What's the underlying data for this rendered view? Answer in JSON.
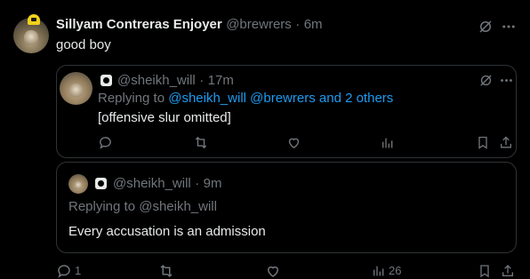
{
  "tweet": {
    "author_name": "Sillyam Contreras Enjoyer",
    "author_handle": "@brewrers",
    "separator": "·",
    "time": "6m",
    "text": "good boy"
  },
  "quoted_reply": {
    "handle": "@sheikh_will",
    "separator": "·",
    "time": "17m",
    "replying_prefix": "Replying to",
    "replying_targets": "@sheikh_will @brewrers and 2 others",
    "text": "[offensive slur omitted]"
  },
  "quoted_tweet": {
    "handle": "@sheikh_will",
    "separator": "·",
    "time": "9m",
    "replying_to": "Replying to @sheikh_will",
    "text": "Every accusation is an admission"
  },
  "bottom_actions": {
    "reply_count": "1",
    "views_count": "26"
  },
  "colors": {
    "background": "#000000",
    "text": "#e7e9ea",
    "muted": "#71767b",
    "link": "#1d9bf0",
    "border": "#2f3336"
  },
  "icons": [
    "grok-icon",
    "more-icon",
    "reply-icon",
    "retweet-icon",
    "like-icon",
    "views-icon",
    "bookmark-icon",
    "share-icon",
    "badge-icon"
  ]
}
